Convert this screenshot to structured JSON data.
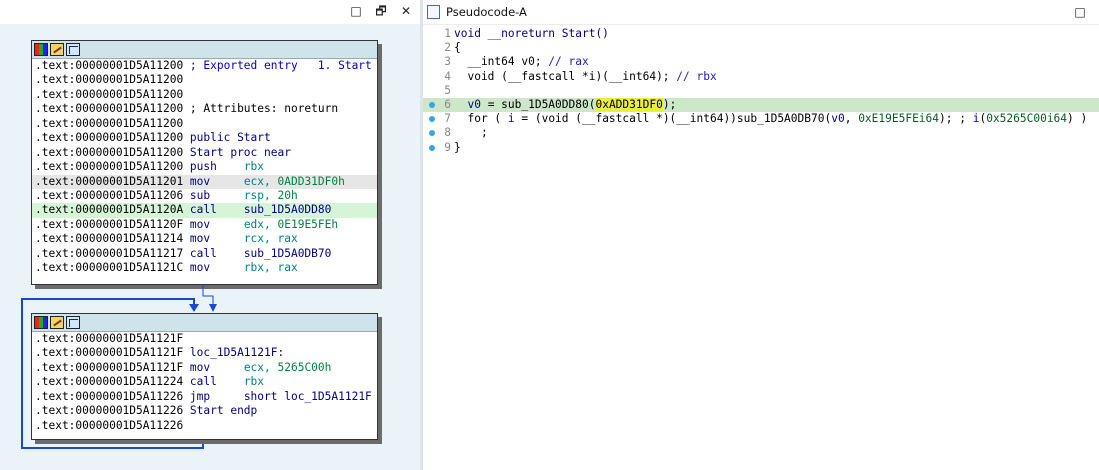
{
  "graph_pane": {
    "window_buttons": [
      "□",
      "🗗",
      "✕"
    ],
    "block1": {
      "lines": [
        {
          "addr": ".text:00000001D5A11200",
          "parts": [
            {
              "t": "cmt",
              "v": " ; Exported entry   1. Start"
            }
          ]
        },
        {
          "addr": ".text:00000001D5A11200",
          "parts": []
        },
        {
          "addr": ".text:00000001D5A11200",
          "parts": []
        },
        {
          "addr": ".text:00000001D5A11200",
          "parts": [
            {
              "t": "plain",
              "v": " ; Attributes: noreturn"
            }
          ]
        },
        {
          "addr": ".text:00000001D5A11200",
          "parts": []
        },
        {
          "addr": ".text:00000001D5A11200",
          "parts": [
            {
              "t": "name",
              "v": " public Start"
            }
          ]
        },
        {
          "addr": ".text:00000001D5A11200",
          "parts": [
            {
              "t": "name",
              "v": " Start proc near"
            }
          ]
        },
        {
          "addr": ".text:00000001D5A11200",
          "parts": [
            {
              "t": "mn",
              "v": " push    "
            },
            {
              "t": "op",
              "v": "rbx"
            }
          ]
        },
        {
          "addr": ".text:00000001D5A11201",
          "hl": "gray",
          "parts": [
            {
              "t": "mn",
              "v": " mov     "
            },
            {
              "t": "op",
              "v": "ecx, "
            },
            {
              "t": "num",
              "v": "0ADD31DF0h"
            }
          ]
        },
        {
          "addr": ".text:00000001D5A11206",
          "parts": [
            {
              "t": "mn",
              "v": " sub     "
            },
            {
              "t": "op",
              "v": "rsp, "
            },
            {
              "t": "num",
              "v": "20h"
            }
          ]
        },
        {
          "addr": ".text:00000001D5A1120A",
          "hl": "green",
          "parts": [
            {
              "t": "mn",
              "v": " call    "
            },
            {
              "t": "name",
              "v": "sub_1D5A0DD80"
            }
          ]
        },
        {
          "addr": ".text:00000001D5A1120F",
          "parts": [
            {
              "t": "mn",
              "v": " mov     "
            },
            {
              "t": "op",
              "v": "edx, "
            },
            {
              "t": "num",
              "v": "0E19E5FEh"
            }
          ]
        },
        {
          "addr": ".text:00000001D5A11214",
          "parts": [
            {
              "t": "mn",
              "v": " mov     "
            },
            {
              "t": "op",
              "v": "rcx, rax"
            }
          ]
        },
        {
          "addr": ".text:00000001D5A11217",
          "parts": [
            {
              "t": "mn",
              "v": " call    "
            },
            {
              "t": "name",
              "v": "sub_1D5A0DB70"
            }
          ]
        },
        {
          "addr": ".text:00000001D5A1121C",
          "parts": [
            {
              "t": "mn",
              "v": " mov     "
            },
            {
              "t": "op",
              "v": "rbx, rax"
            }
          ]
        }
      ]
    },
    "block2": {
      "lines": [
        {
          "addr": ".text:00000001D5A1121F",
          "parts": []
        },
        {
          "addr": ".text:00000001D5A1121F",
          "parts": [
            {
              "t": "name",
              "v": " loc_1D5A1121F:"
            }
          ]
        },
        {
          "addr": ".text:00000001D5A1121F",
          "parts": [
            {
              "t": "mn",
              "v": " mov     "
            },
            {
              "t": "op",
              "v": "ecx, "
            },
            {
              "t": "num",
              "v": "5265C00h"
            }
          ]
        },
        {
          "addr": ".text:00000001D5A11224",
          "parts": [
            {
              "t": "mn",
              "v": " call    "
            },
            {
              "t": "op",
              "v": "rbx"
            }
          ]
        },
        {
          "addr": ".text:00000001D5A11226",
          "parts": [
            {
              "t": "mn",
              "v": " jmp     "
            },
            {
              "t": "name",
              "v": "short loc_1D5A1121F"
            }
          ]
        },
        {
          "addr": ".text:00000001D5A11226",
          "parts": [
            {
              "t": "name",
              "v": " Start endp"
            }
          ]
        },
        {
          "addr": ".text:00000001D5A11226",
          "parts": []
        }
      ]
    }
  },
  "code_pane": {
    "tab_title": "Pseudocode-A",
    "maximize_button": "□",
    "lines": [
      {
        "n": "1",
        "dot": false,
        "parts": [
          {
            "t": "kw",
            "v": "void __noreturn Start()"
          }
        ]
      },
      {
        "n": "2",
        "dot": false,
        "parts": [
          {
            "t": "plain",
            "v": "{"
          }
        ]
      },
      {
        "n": "3",
        "dot": false,
        "parts": [
          {
            "t": "plain",
            "v": "  __int64 v0; "
          },
          {
            "t": "cm",
            "v": "// rax"
          }
        ]
      },
      {
        "n": "4",
        "dot": false,
        "parts": [
          {
            "t": "plain",
            "v": "  void (__fastcall *i)(__int64); "
          },
          {
            "t": "cm",
            "v": "// rbx"
          }
        ]
      },
      {
        "n": "5",
        "dot": false,
        "parts": []
      },
      {
        "n": "6",
        "dot": true,
        "hl": true,
        "parts": [
          {
            "t": "var",
            "v": "  v0"
          },
          {
            "t": "plain",
            "v": " = sub_1D5A0DD80("
          },
          {
            "t": "yhl",
            "v": "0xADD31DF0"
          },
          {
            "t": "plain",
            "v": ");"
          }
        ]
      },
      {
        "n": "7",
        "dot": true,
        "parts": [
          {
            "t": "plain",
            "v": "  for ( "
          },
          {
            "t": "var",
            "v": "i"
          },
          {
            "t": "plain",
            "v": " = (void (__fastcall *)(__int64))sub_1D5A0DB70("
          },
          {
            "t": "var",
            "v": "v0"
          },
          {
            "t": "plain",
            "v": ", "
          },
          {
            "t": "num",
            "v": "0xE19E5FEi64"
          },
          {
            "t": "plain",
            "v": "); ; "
          },
          {
            "t": "var",
            "v": "i"
          },
          {
            "t": "plain",
            "v": "("
          },
          {
            "t": "num",
            "v": "0x5265C00i64"
          },
          {
            "t": "plain",
            "v": ") )"
          }
        ]
      },
      {
        "n": "8",
        "dot": true,
        "parts": [
          {
            "t": "plain",
            "v": "    ;"
          }
        ]
      },
      {
        "n": "9",
        "dot": true,
        "parts": [
          {
            "t": "plain",
            "v": "}"
          }
        ]
      }
    ]
  }
}
